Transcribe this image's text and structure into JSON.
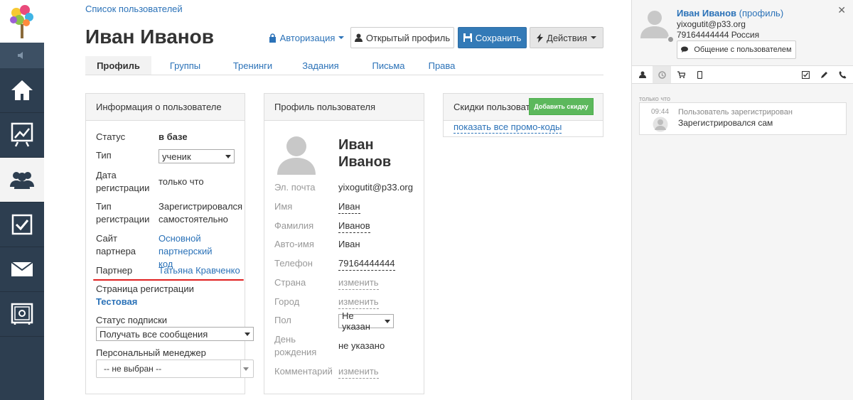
{
  "breadcrumb": "Список пользователей",
  "title": "Иван Иванов",
  "toolbar": {
    "auth": "Авторизация",
    "open_profile": "Открытый профиль",
    "save": "Сохранить",
    "actions": "Действия"
  },
  "tabs": [
    "Профиль",
    "Группы",
    "Тренинги",
    "Задания",
    "Письма",
    "Права"
  ],
  "user_info": {
    "heading": "Информация о пользователе",
    "status_label": "Статус",
    "status_value": "в базе",
    "type_label": "Тип",
    "type_value": "ученик",
    "reg_date_label_1": "Дата",
    "reg_date_label_2": "регистрации",
    "reg_date_value": "только что",
    "reg_type_label_1": "Тип",
    "reg_type_label_2": "регистрации",
    "reg_type_value_1": "Зарегистрировался",
    "reg_type_value_2": "самостоятельно",
    "partner_site_label_1": "Сайт",
    "partner_site_label_2": "партнера",
    "partner_site_value_1": "Основной партнерский",
    "partner_site_value_2": "код",
    "partner_label": "Партнер",
    "partner_value": "Татьяна Кравченко",
    "reg_page_label": "Страница регистрации",
    "reg_page_value": "Тестовая",
    "sub_status_label": "Статус подписки",
    "sub_status_value": "Получать все сообщения",
    "manager_label": "Персональный менеджер",
    "manager_value": "-- не выбран --"
  },
  "profile": {
    "heading": "Профиль пользователя",
    "name_line1": "Иван",
    "name_line2": "Иванов",
    "email_label": "Эл. почта",
    "email_value": "yixogutit@p33.org",
    "first_label": "Имя",
    "first_value": "Иван",
    "last_label": "Фамилия",
    "last_value": "Иванов",
    "auto_label": "Авто-имя",
    "auto_value": "Иван",
    "phone_label": "Телефон",
    "phone_value": "79164444444",
    "country_label": "Страна",
    "country_value": "изменить",
    "city_label": "Город",
    "city_value": "изменить",
    "gender_label": "Пол",
    "gender_value": "Не указан",
    "birthday_label_1": "День",
    "birthday_label_2": "рождения",
    "birthday_value": "не указано",
    "comment_label": "Комментарий",
    "comment_value": "изменить"
  },
  "discounts": {
    "heading": "Скидки пользовате",
    "add_button": "Добавить скидку",
    "show_promo": "показать все промо-коды"
  },
  "right_panel": {
    "name": "Иван Иванов",
    "profile_link": "(профиль)",
    "email": "yixogutit@p33.org",
    "phone_country": "79164444444 Россия",
    "chat_button": "Общение с пользователем",
    "time_label": "только что",
    "event_time": "09:44",
    "event_title": "Пользователь зарегистрирован",
    "event_text": "Зарегистрировался сам"
  },
  "colors": {
    "sidebar": "#2d3e50",
    "primary": "#337ab7",
    "link": "#2b72b8",
    "success": "#5cb85c",
    "underline": "#e02020"
  }
}
